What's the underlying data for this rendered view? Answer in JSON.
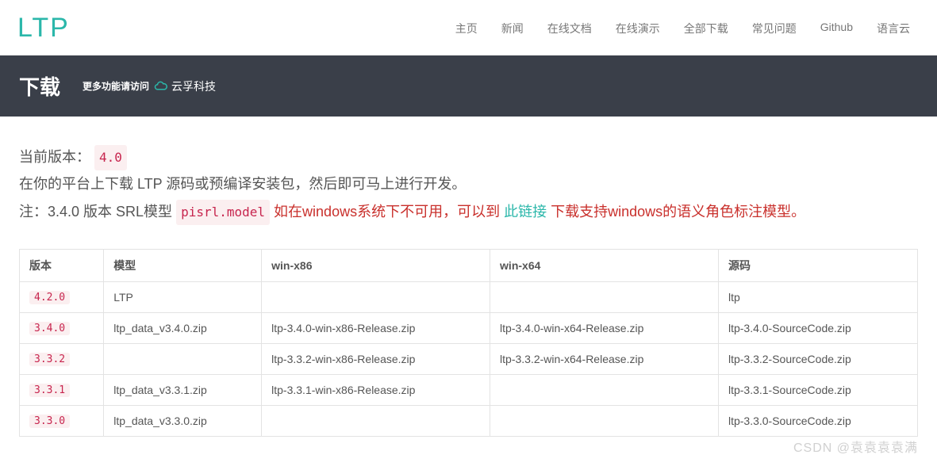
{
  "logo": "LTP",
  "nav": {
    "items": [
      "主页",
      "新闻",
      "在线文档",
      "在线演示",
      "全部下载",
      "常见问题",
      "Github",
      "语言云"
    ]
  },
  "titlebar": {
    "title": "下载",
    "more_text": "更多功能请访问",
    "cloud_name": "云孚科技"
  },
  "desc": {
    "line1_a": "当前版本：",
    "line1_ver": "4.0",
    "line2": "在你的平台上下载 LTP 源码或预编译安装包，然后即可马上进行开发。",
    "line3_a": "注：3.4.0 版本 SRL模型 ",
    "line3_code": "pisrl.model",
    "line3_b": " 如在windows系统下不可用，可以到 ",
    "line3_link": "此链接",
    "line3_c": " 下载支持windows的语义角色标注模型。"
  },
  "table": {
    "headers": [
      "版本",
      "模型",
      "win-x86",
      "win-x64",
      "源码"
    ],
    "rows": [
      {
        "ver": "4.2.0",
        "model": "LTP",
        "x86": "",
        "x64": "",
        "src": "ltp"
      },
      {
        "ver": "3.4.0",
        "model": "ltp_data_v3.4.0.zip",
        "x86": "ltp-3.4.0-win-x86-Release.zip",
        "x64": "ltp-3.4.0-win-x64-Release.zip",
        "src": "ltp-3.4.0-SourceCode.zip"
      },
      {
        "ver": "3.3.2",
        "model": "",
        "x86": "ltp-3.3.2-win-x86-Release.zip",
        "x64": "ltp-3.3.2-win-x64-Release.zip",
        "src": "ltp-3.3.2-SourceCode.zip"
      },
      {
        "ver": "3.3.1",
        "model": "ltp_data_v3.3.1.zip",
        "x86": "ltp-3.3.1-win-x86-Release.zip",
        "x64": "",
        "src": "ltp-3.3.1-SourceCode.zip"
      },
      {
        "ver": "3.3.0",
        "model": "ltp_data_v3.3.0.zip",
        "x86": "",
        "x64": "",
        "src": "ltp-3.3.0-SourceCode.zip"
      }
    ]
  },
  "watermark": "CSDN @袁袁袁袁满"
}
